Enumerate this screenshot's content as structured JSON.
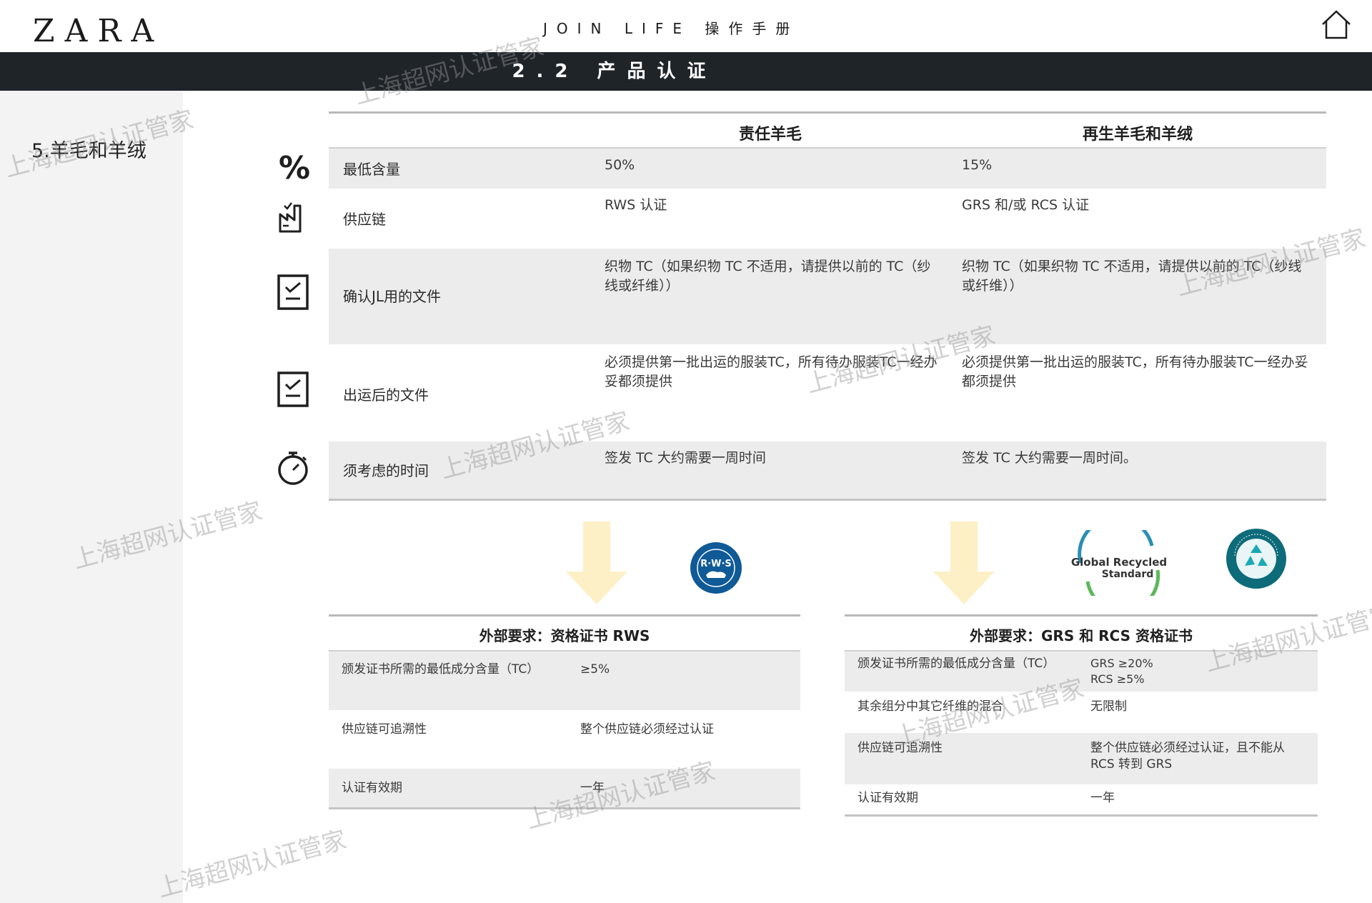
{
  "header": {
    "logo": "ZARA",
    "title": "JOIN LIFE 操作手册",
    "section": "2.2 产品认证"
  },
  "sidebar": {
    "items": [
      {
        "label": "5.羊毛和羊绒"
      }
    ]
  },
  "table": {
    "columns": [
      "责任羊毛",
      "再生羊毛和羊绒"
    ],
    "rows": [
      {
        "icon": "percent-icon",
        "label": "最低含量",
        "values": [
          "50%",
          "15%"
        ]
      },
      {
        "icon": "factory-icon",
        "label": "供应链",
        "values": [
          "RWS 认证",
          "GRS 和/或 RCS 认证"
        ]
      },
      {
        "icon": "checklist-icon",
        "label": "确认JL用的文件",
        "values": [
          "织物 TC（如果织物 TC 不适用，请提供以前的 TC（纱线或纤维））",
          "织物 TC（如果织物 TC 不适用，请提供以前的 TC（纱线或纤维））"
        ]
      },
      {
        "icon": "checklist-icon",
        "label": "出运后的文件",
        "values": [
          "必须提供第一批出运的服装TC，所有待办服装TC一经办妥都须提供",
          "必须提供第一批出运的服装TC，所有待办服装TC一经办妥都须提供"
        ]
      },
      {
        "icon": "stopwatch-icon",
        "label": "须考虑的时间",
        "values": [
          "签发 TC 大约需要一周时间",
          "签发 TC 大约需要一周时间。"
        ]
      }
    ]
  },
  "logos": {
    "rws": "RWS",
    "grs": [
      "Global Recycled",
      "Standard"
    ],
    "rcs": "RECYCLED 100 claim standard"
  },
  "rws_table": {
    "title": "外部要求：资格证书 RWS",
    "rows": [
      {
        "label": "颁发证书所需的最低成分含量（TC）",
        "value": "≥5%"
      },
      {
        "label": "供应链可追溯性",
        "value": "整个供应链必须经过认证"
      },
      {
        "label": "认证有效期",
        "value": "一年"
      }
    ]
  },
  "grs_table": {
    "title": "外部要求：GRS 和 RCS 资格证书",
    "rows": [
      {
        "label": "颁发证书所需的最低成分含量（TC）",
        "value": "GRS ≥20%\nRCS ≥5%"
      },
      {
        "label": "其余组分中其它纤维的混合",
        "value": "无限制"
      },
      {
        "label": "供应链可追溯性",
        "value": "整个供应链必须经过认证，且不能从 RCS 转到 GRS"
      },
      {
        "label": "认证有效期",
        "value": "一年"
      }
    ]
  },
  "watermark": "上海超网认证管家",
  "colors": {
    "header_bar": "#1f2429",
    "row_shade": "#ececec",
    "arrow": "#fdf0c6"
  }
}
